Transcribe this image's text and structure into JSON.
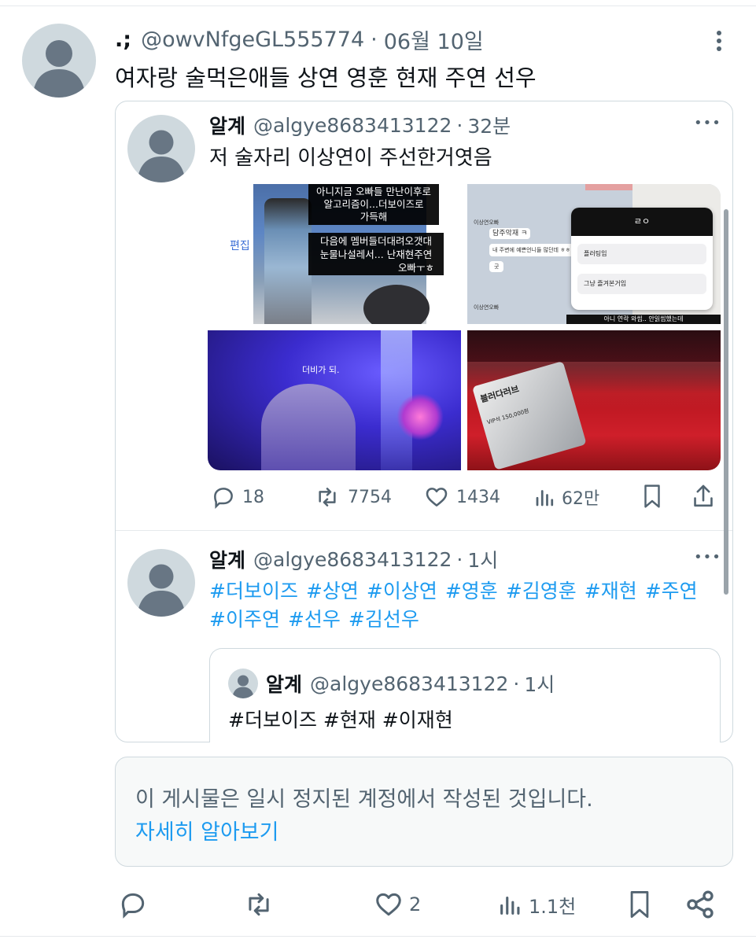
{
  "main_post": {
    "display_name": ".;",
    "handle": "@owvNfgeGL555774",
    "date": "06월 10일",
    "text": "여자랑 술먹은애들 상연 영훈 현재 주연 선우",
    "actions": {
      "replies": "",
      "reposts": "",
      "likes": "2",
      "views": "1.1천"
    }
  },
  "quoted_thread": {
    "post1": {
      "display_name": "알계",
      "handle": "@algye8683413122",
      "time": "32분",
      "text": "저 술자리 이상연이 주선한거엿음",
      "media": {
        "tile1": {
          "captions": [
            "아니지금 오빠들 만난이후로",
            "알고리즘이...더보이즈로",
            "가득해",
            "다음에 멤버들더대려오갯대",
            "눈물나설레서... 난재현주연",
            "오빠ㅜㅎ"
          ],
          "side_label": "편집"
        },
        "tile2": {
          "chat_lines": [
            "이상연오빠",
            "담주악재 ㅋ",
            "내 주변에 예쁜언니들 많던데 ㅎㅎ",
            "굿",
            "이상연오빠"
          ],
          "menu_title": "ㄹㅇ",
          "menu_options": [
            "플러팅임",
            "그냥 즐겨본거임"
          ],
          "bottom_text": "아니 연락 와씹.. 안읽씹했는데"
        },
        "tile3": {
          "caption": "더비가 되."
        },
        "tile4": {
          "ticket_text": "블러다러브",
          "ticket_sub": "VIP석 150,000원"
        }
      },
      "actions": {
        "replies": "18",
        "reposts": "7754",
        "likes": "1434",
        "views": "62만"
      }
    },
    "post2": {
      "display_name": "알계",
      "handle": "@algye8683413122",
      "time": "1시",
      "hashtags_line1": [
        "#더보이즈",
        "#상연",
        "#이상연",
        "#영훈",
        "#김영훈",
        "#재현",
        "#주연"
      ],
      "hashtags_line2": [
        "#이주연",
        "#선우",
        "#김선우"
      ],
      "nested_quote": {
        "display_name": "알계",
        "handle": "@algye8683413122",
        "time": "1시",
        "text": "#더보이즈 #현재 #이재현"
      }
    }
  },
  "notice": {
    "text": "이 게시물은 일시 정지된 계정에서 작성된 것입니다.",
    "link": "자세히 알아보기"
  },
  "separator": "·",
  "more_glyph": "•••",
  "colors": {
    "accent": "#1d9bf0",
    "gray_text": "#536471",
    "border": "#cfd9de",
    "notice_bg": "#f7f9f9"
  },
  "icons": [
    "more-vertical-icon",
    "more-horizontal-icon",
    "reply-icon",
    "repost-icon",
    "like-icon",
    "views-icon",
    "bookmark-icon",
    "share-icon"
  ]
}
